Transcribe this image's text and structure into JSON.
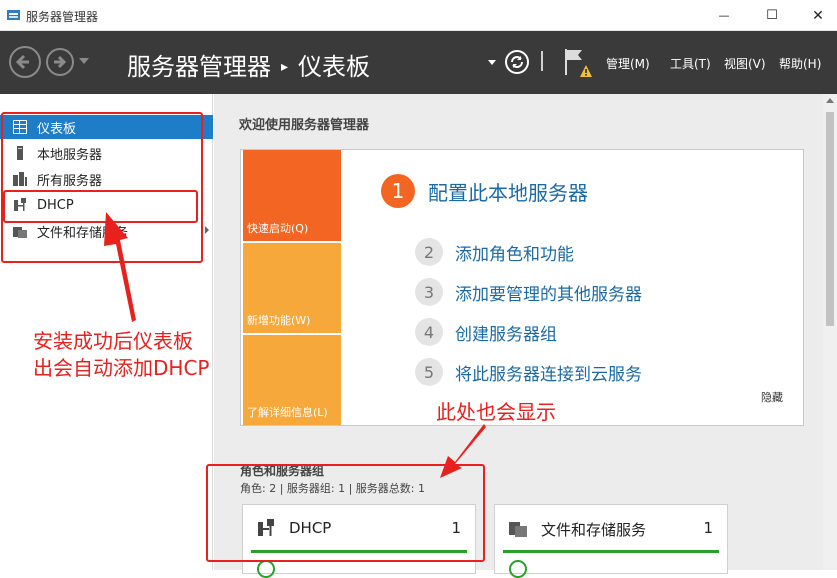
{
  "window": {
    "title": "服务器管理器",
    "minimize_glyph": "—",
    "maximize_glyph": "☐",
    "close_glyph": "✕"
  },
  "header": {
    "breadcrumb_root": "服务器管理器",
    "breadcrumb_sep": "▸",
    "breadcrumb_current": "仪表板",
    "menus": [
      "管理(M)",
      "工具(T)",
      "视图(V)",
      "帮助(H)"
    ]
  },
  "sidebar": {
    "items": [
      {
        "label": "仪表板",
        "icon": "dashboard-grid-icon",
        "active": true
      },
      {
        "label": "本地服务器",
        "icon": "server-icon",
        "active": false
      },
      {
        "label": "所有服务器",
        "icon": "servers-icon",
        "active": false
      },
      {
        "label": "DHCP",
        "icon": "dhcp-icon",
        "active": false
      },
      {
        "label": "文件和存储服务",
        "icon": "storage-icon",
        "active": false
      }
    ]
  },
  "main": {
    "welcome_title": "欢迎使用服务器管理器",
    "quick_start": {
      "tiles": [
        "快速启动(Q)",
        "新增功能(W)",
        "了解详细信息(L)"
      ],
      "main_step": {
        "num": "1",
        "label": "配置此本地服务器"
      },
      "steps": [
        {
          "num": "2",
          "label": "添加角色和功能"
        },
        {
          "num": "3",
          "label": "添加要管理的其他服务器"
        },
        {
          "num": "4",
          "label": "创建服务器组"
        },
        {
          "num": "5",
          "label": "将此服务器连接到云服务"
        }
      ],
      "hide_label": "隐藏"
    },
    "roles": {
      "title": "角色和服务器组",
      "summary": "角色: 2 | 服务器组: 1 | 服务器总数: 1",
      "cards": [
        {
          "title": "DHCP",
          "count": "1",
          "icon": "dhcp-icon"
        },
        {
          "title": "文件和存储服务",
          "count": "1",
          "icon": "storage-icon"
        }
      ]
    }
  },
  "annotations": {
    "sidebar_note_line1": "安装成功后仪表板",
    "sidebar_note_line2": "出会自动添加DHCP",
    "card_note": "此处也会显示"
  },
  "colors": {
    "header_bg": "#3a3a3a",
    "active_item": "#1e7dc8",
    "quick_start_orange": "#f26522",
    "tile_orange_light": "#f7a83a",
    "link_blue": "#1c6aa5",
    "annotation_red": "#e8201e",
    "status_green": "#2aa02a"
  }
}
